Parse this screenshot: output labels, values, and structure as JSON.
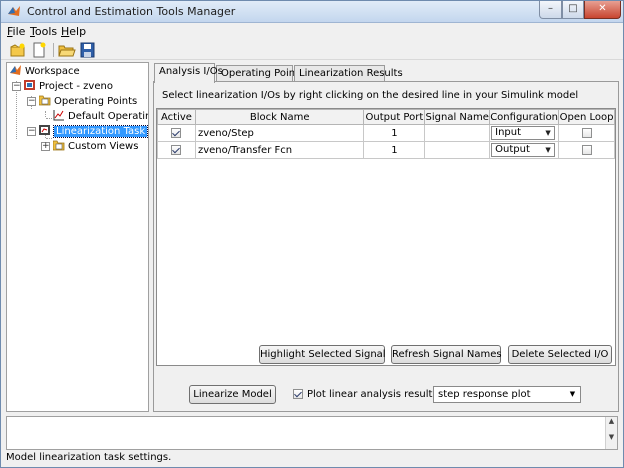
{
  "window": {
    "title": "Control and Estimation Tools Manager"
  },
  "window_controls": {
    "minimize": "–",
    "maximize": "□",
    "close": "✕"
  },
  "menu": [
    {
      "label": "File",
      "underline": "F"
    },
    {
      "label": "Tools",
      "underline": "T"
    },
    {
      "label": "Help",
      "underline": "H"
    }
  ],
  "toolbar": {
    "buttons": [
      "new-project-icon",
      "new-task-icon",
      "open-folder-icon",
      "save-disk-icon"
    ]
  },
  "tree": {
    "workspace": "Workspace",
    "project": "Project - zveno",
    "operating_points": "Operating Points",
    "default_operating_point": "Default Operating P",
    "linearization_task": "Linearization Task",
    "custom_views": "Custom Views"
  },
  "tabs": [
    "Analysis I/Os",
    "Operating Points",
    "Linearization Results"
  ],
  "active_tab": 0,
  "instructions": "Select linearization I/Os by right clicking on the desired line in your Simulink model",
  "table": {
    "columns": [
      "Active",
      "Block Name",
      "Output Port",
      "Signal Name",
      "Configuration",
      "Open Loop"
    ],
    "rows": [
      {
        "active": true,
        "block": "zveno/Step",
        "port": "1",
        "signal": "",
        "config": "Input",
        "open_loop": false
      },
      {
        "active": true,
        "block": "zveno/Transfer Fcn",
        "port": "1",
        "signal": "",
        "config": "Output",
        "open_loop": false
      }
    ]
  },
  "buttons": {
    "highlight": "Highlight Selected Signal",
    "refresh": "Refresh Signal Names",
    "delete": "Delete Selected I/O",
    "linearize": "Linearize Model"
  },
  "plot_option": {
    "label": "Plot linear analysis result in a",
    "checked": true,
    "selected": "step response plot"
  },
  "status": "Model linearization task settings.",
  "colors": {
    "selection": "#3399ff",
    "titlebar": "#c3d6ee",
    "close": "#c8452f"
  }
}
